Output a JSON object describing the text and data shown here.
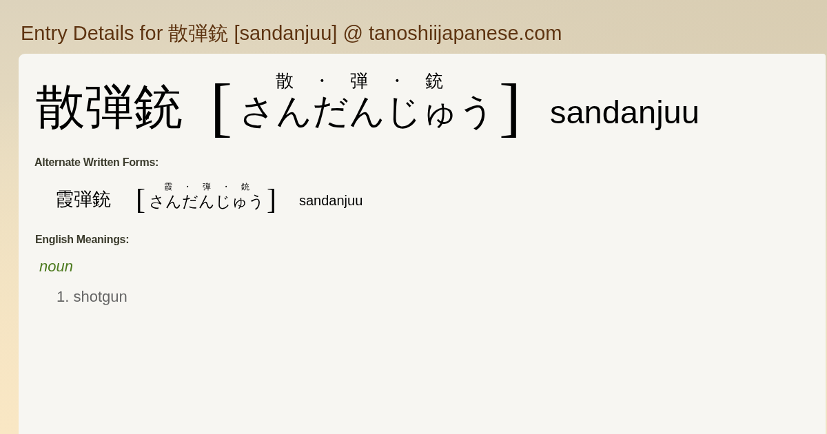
{
  "header": {
    "title": "Entry Details for 散弾銃 [sandanjuu] @ tanoshiijapanese.com"
  },
  "entry": {
    "kanji": "散弾銃",
    "open_bracket": "[",
    "furigana": "散 ・ 弾 ・ 銃",
    "kana": "さんだんじゅう",
    "close_bracket": "]",
    "romaji": "sandanjuu"
  },
  "alternate_forms": {
    "heading": "Alternate Written Forms:",
    "forms": [
      {
        "kanji": "霞弾銃",
        "open_bracket": "[",
        "furigana": "霞 ・ 弾 ・ 銃",
        "kana": "さんだんじゅう",
        "close_bracket": "]",
        "romaji": "sandanjuu"
      }
    ]
  },
  "meanings": {
    "heading": "English Meanings:",
    "groups": [
      {
        "part_of_speech": "noun",
        "senses": [
          "1. shotgun"
        ]
      }
    ]
  }
}
